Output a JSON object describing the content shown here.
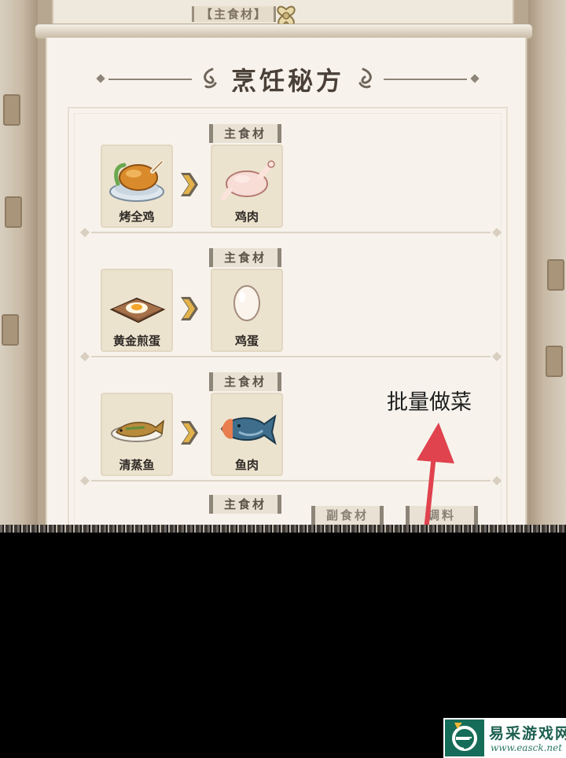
{
  "back_card": {
    "tag": "【主食材】"
  },
  "title": "烹饪秘方",
  "main_ingredient_tag": "主食材",
  "recipes": [
    {
      "dish": "烤全鸡",
      "dish_icon": "roast-chicken-icon",
      "ingredient": "鸡肉",
      "ingredient_icon": "raw-chicken-icon"
    },
    {
      "dish": "黄金煎蛋",
      "dish_icon": "fried-egg-icon",
      "ingredient": "鸡蛋",
      "ingredient_icon": "egg-icon"
    },
    {
      "dish": "清蒸鱼",
      "dish_icon": "steamed-fish-icon",
      "ingredient": "鱼肉",
      "ingredient_icon": "fish-icon"
    }
  ],
  "partial_row": {
    "main_tag": "主食材",
    "side_tag": "副食材",
    "seasoning_tag": "调料"
  },
  "annotation": "批量做菜",
  "watermark": {
    "name": "易采游戏网",
    "url": "www.easck.net"
  },
  "colors": {
    "paper": "#f7f3ec",
    "slot": "#ece3cf",
    "annotation_arrow": "#e0424e",
    "watermark_green": "#156c58"
  }
}
